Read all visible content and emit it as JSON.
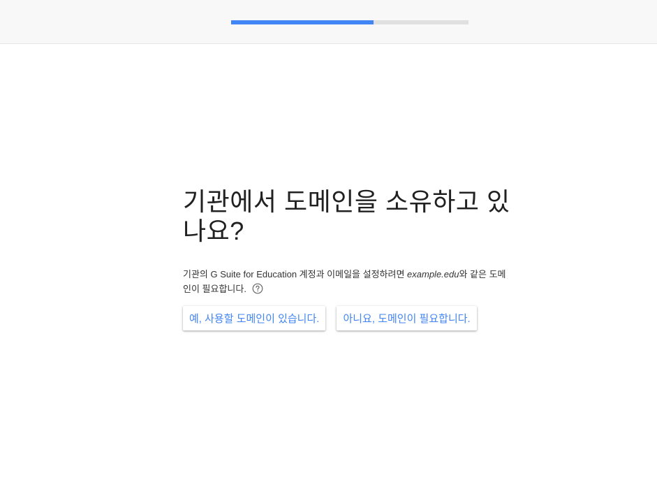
{
  "progress": {
    "fraction": 0.6,
    "fill_color": "#4285f4",
    "track_color": "#e0e0e0"
  },
  "main": {
    "title": "기관에서 도메인을 소유하고 있나요?",
    "description_before": "기관의 G Suite for Education 계정과 이메일을 설정하려면 ",
    "description_example": "example.edu",
    "description_after": "와 같은 도메인이 필요합니다.",
    "help_icon": "help-circle-icon"
  },
  "buttons": {
    "yes_label": "예, 사용할 도메인이 있습니다.",
    "no_label": "아니요, 도메인이 필요합니다."
  }
}
